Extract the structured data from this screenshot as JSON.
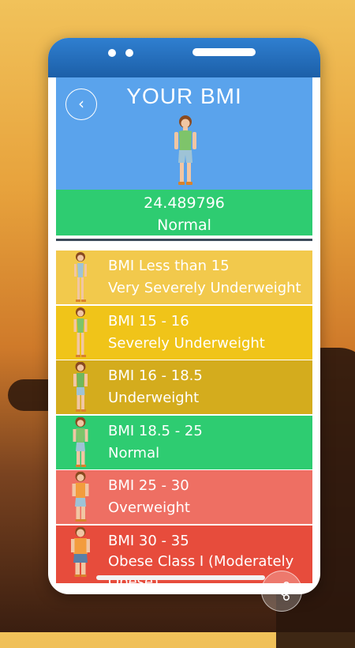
{
  "header": {
    "title": "YOUR BMI",
    "back_icon": "chevron-left-icon",
    "bmi_value": "24.489796",
    "bmi_status": "Normal",
    "color": "#5aa3ec",
    "result_color": "#2ecc71"
  },
  "categories": [
    {
      "range": "BMI Less than 15",
      "label": "Very Severely Underweight",
      "color": "#f2c94c"
    },
    {
      "range": "BMI 15 - 16",
      "label": "Severely Underweight",
      "color": "#f0c419"
    },
    {
      "range": "BMI 16 - 18.5",
      "label": "Underweight",
      "color": "#d4ac1d"
    },
    {
      "range": "BMI 18.5 - 25",
      "label": "Normal",
      "color": "#2ecc71"
    },
    {
      "range": "BMI 25 - 30",
      "label": "Overweight",
      "color": "#ee6f63"
    },
    {
      "range": "BMI 30 - 35",
      "label": "Obese Class I (Moderately Obese)",
      "color": "#e74c3c"
    }
  ],
  "share_icon": "share-icon"
}
